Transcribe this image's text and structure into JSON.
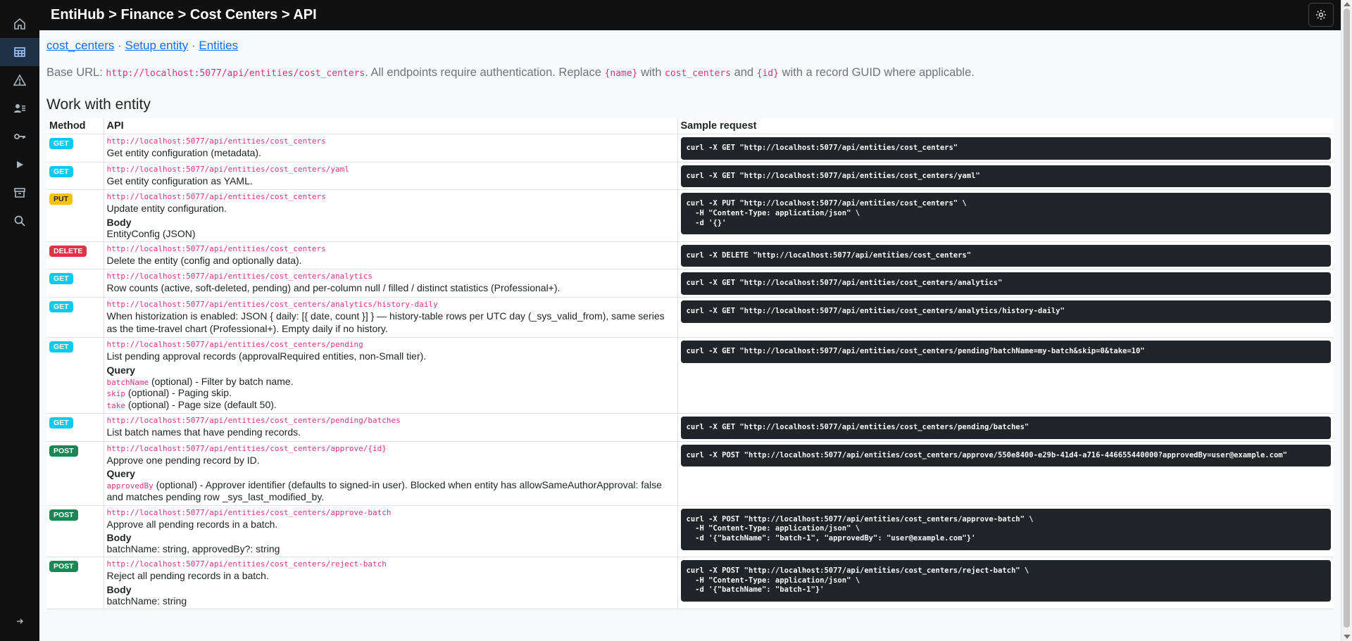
{
  "topbar": {
    "breadcrumb": "EntiHub > Finance > Cost Centers > API"
  },
  "sidebar": {
    "items": [
      {
        "icon": "home-icon"
      },
      {
        "icon": "table-icon",
        "active": true
      },
      {
        "icon": "warning-icon"
      },
      {
        "icon": "users-icon"
      },
      {
        "icon": "key-icon"
      },
      {
        "icon": "play-icon"
      },
      {
        "icon": "archive-icon"
      },
      {
        "icon": "search-icon"
      }
    ]
  },
  "links": {
    "entity": "cost_centers",
    "sep1": " · ",
    "setup": "Setup entity",
    "sep2": " · ",
    "entities": "Entities"
  },
  "base": {
    "prefix": "Base URL: ",
    "url": "http://localhost:5077/api/entities/cost_centers",
    "t1": ". All endpoints require authentication. Replace ",
    "name_ph": "{name}",
    "t2": " with ",
    "name_val": "cost_centers",
    "t3": " and ",
    "id_ph": "{id}",
    "t4": " with a record GUID where applicable."
  },
  "section_title": "Work with entity",
  "table": {
    "headers": {
      "method": "Method",
      "api": "API",
      "sample": "Sample request"
    },
    "rows": [
      {
        "method": "GET",
        "cls": "get",
        "url": "http://localhost:5077/api/entities/cost_centers",
        "desc": "Get entity configuration (metadata).",
        "sample": "curl -X GET \"http://localhost:5077/api/entities/cost_centers\""
      },
      {
        "method": "GET",
        "cls": "get",
        "url": "http://localhost:5077/api/entities/cost_centers/yaml",
        "desc": "Get entity configuration as YAML.",
        "sample": "curl -X GET \"http://localhost:5077/api/entities/cost_centers/yaml\""
      },
      {
        "method": "PUT",
        "cls": "put",
        "url": "http://localhost:5077/api/entities/cost_centers",
        "desc": "Update entity configuration.",
        "body_label": "Body",
        "body": "EntityConfig (JSON)",
        "sample": "curl -X PUT \"http://localhost:5077/api/entities/cost_centers\" \\\n  -H \"Content-Type: application/json\" \\\n  -d '{}'"
      },
      {
        "method": "DELETE",
        "cls": "delete",
        "url": "http://localhost:5077/api/entities/cost_centers",
        "desc": "Delete the entity (config and optionally data).",
        "sample": "curl -X DELETE \"http://localhost:5077/api/entities/cost_centers\""
      },
      {
        "method": "GET",
        "cls": "get",
        "url": "http://localhost:5077/api/entities/cost_centers/analytics",
        "desc": "Row counts (active, soft-deleted, pending) and per-column null / filled / distinct statistics (Professional+).",
        "sample": "curl -X GET \"http://localhost:5077/api/entities/cost_centers/analytics\""
      },
      {
        "method": "GET",
        "cls": "get",
        "url": "http://localhost:5077/api/entities/cost_centers/analytics/history-daily",
        "desc": "When historization is enabled: JSON { daily: [{ date, count }] } — history-table rows per UTC day (_sys_valid_from), same series as the time-travel chart (Professional+). Empty daily if no history.",
        "sample": "curl -X GET \"http://localhost:5077/api/entities/cost_centers/analytics/history-daily\""
      },
      {
        "method": "GET",
        "cls": "get",
        "url": "http://localhost:5077/api/entities/cost_centers/pending",
        "desc": "List pending approval records (approvalRequired entities, non-Small tier).",
        "query_label": "Query",
        "query": [
          {
            "name": "batchName",
            "text": " (optional) - Filter by batch name."
          },
          {
            "name": "skip",
            "text": " (optional) - Paging skip."
          },
          {
            "name": "take",
            "text": " (optional) - Page size (default 50)."
          }
        ],
        "sample": "curl -X GET \"http://localhost:5077/api/entities/cost_centers/pending?batchName=my-batch&skip=0&take=10\""
      },
      {
        "method": "GET",
        "cls": "get",
        "url": "http://localhost:5077/api/entities/cost_centers/pending/batches",
        "desc": "List batch names that have pending records.",
        "sample": "curl -X GET \"http://localhost:5077/api/entities/cost_centers/pending/batches\""
      },
      {
        "method": "POST",
        "cls": "post",
        "url": "http://localhost:5077/api/entities/cost_centers/approve/{id}",
        "desc": "Approve one pending record by ID.",
        "query_label": "Query",
        "query": [
          {
            "name": "approvedBy",
            "text": " (optional) - Approver identifier (defaults to signed-in user). Blocked when entity has allowSameAuthorApproval: false and matches pending row _sys_last_modified_by."
          }
        ],
        "sample": "curl -X POST \"http://localhost:5077/api/entities/cost_centers/approve/550e8400-e29b-41d4-a716-446655440000?approvedBy=user@example.com\""
      },
      {
        "method": "POST",
        "cls": "post",
        "url": "http://localhost:5077/api/entities/cost_centers/approve-batch",
        "desc": "Approve all pending records in a batch.",
        "body_label": "Body",
        "body": "batchName: string, approvedBy?: string",
        "sample": "curl -X POST \"http://localhost:5077/api/entities/cost_centers/approve-batch\" \\\n  -H \"Content-Type: application/json\" \\\n  -d '{\"batchName\": \"batch-1\", \"approvedBy\": \"user@example.com\"}'"
      },
      {
        "method": "POST",
        "cls": "post",
        "url": "http://localhost:5077/api/entities/cost_centers/reject-batch",
        "desc": "Reject all pending records in a batch.",
        "body_label": "Body",
        "body": "batchName: string",
        "sample": "curl -X POST \"http://localhost:5077/api/entities/cost_centers/reject-batch\" \\\n  -H \"Content-Type: application/json\" \\\n  -d '{\"batchName\": \"batch-1\"}'"
      }
    ]
  }
}
